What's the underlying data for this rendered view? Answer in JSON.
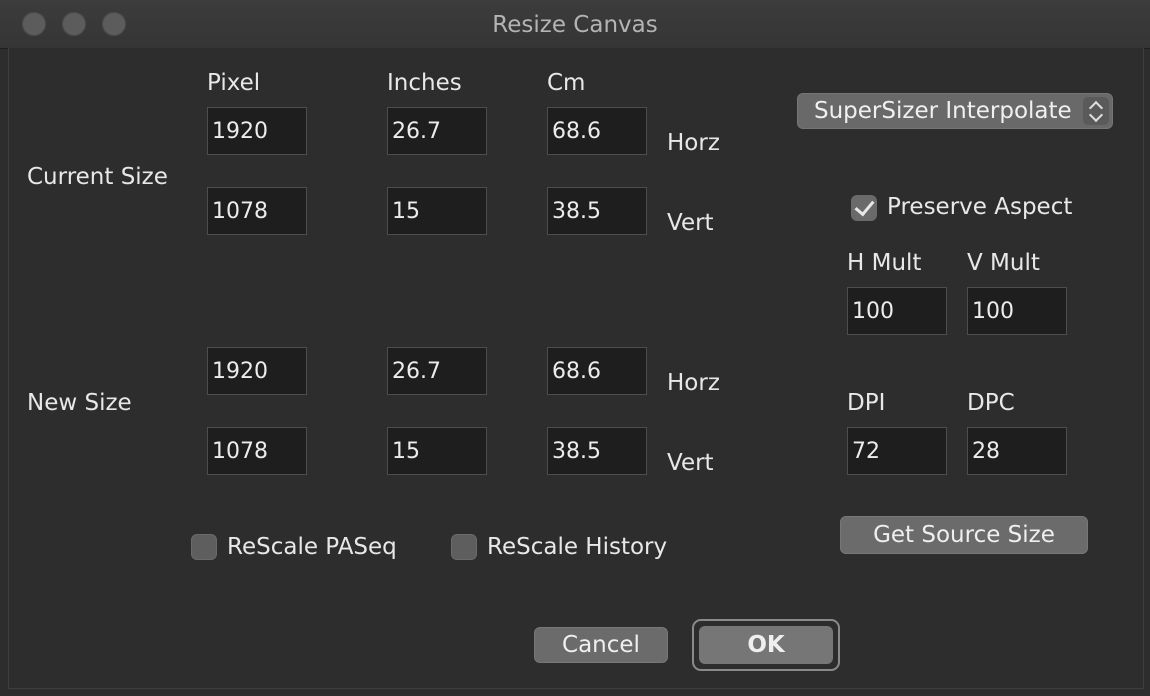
{
  "window": {
    "title": "Resize Canvas"
  },
  "columns": {
    "pixel": "Pixel",
    "inches": "Inches",
    "cm": "Cm"
  },
  "current_size": {
    "label": "Current Size",
    "horz": {
      "pixel": "1920",
      "inches": "26.7",
      "cm": "68.6",
      "label": "Horz"
    },
    "vert": {
      "pixel": "1078",
      "inches": "15",
      "cm": "38.5",
      "label": "Vert"
    }
  },
  "new_size": {
    "label": "New Size",
    "horz": {
      "pixel": "1920",
      "inches": "26.7",
      "cm": "68.6",
      "label": "Horz"
    },
    "vert": {
      "pixel": "1078",
      "inches": "15",
      "cm": "38.5",
      "label": "Vert"
    }
  },
  "interpolation": {
    "selected": "SuperSizer Interpolate"
  },
  "preserve_aspect": {
    "label": "Preserve Aspect",
    "checked": true
  },
  "mult": {
    "h_label": "H Mult",
    "v_label": "V Mult",
    "h_value": "100",
    "v_value": "100"
  },
  "resolution": {
    "dpi_label": "DPI",
    "dpc_label": "DPC",
    "dpi_value": "72",
    "dpc_value": "28"
  },
  "get_source_size": {
    "label": "Get Source Size"
  },
  "rescale": {
    "paseq_label": "ReScale PASeq",
    "paseq_checked": false,
    "history_label": "ReScale History",
    "history_checked": false
  },
  "buttons": {
    "cancel": "Cancel",
    "ok": "OK"
  },
  "colors": {
    "window_bg": "#2d2d2d",
    "field_bg": "#1e1e1e",
    "button_bg": "#6b6b6b",
    "text": "#e8e8e8"
  }
}
